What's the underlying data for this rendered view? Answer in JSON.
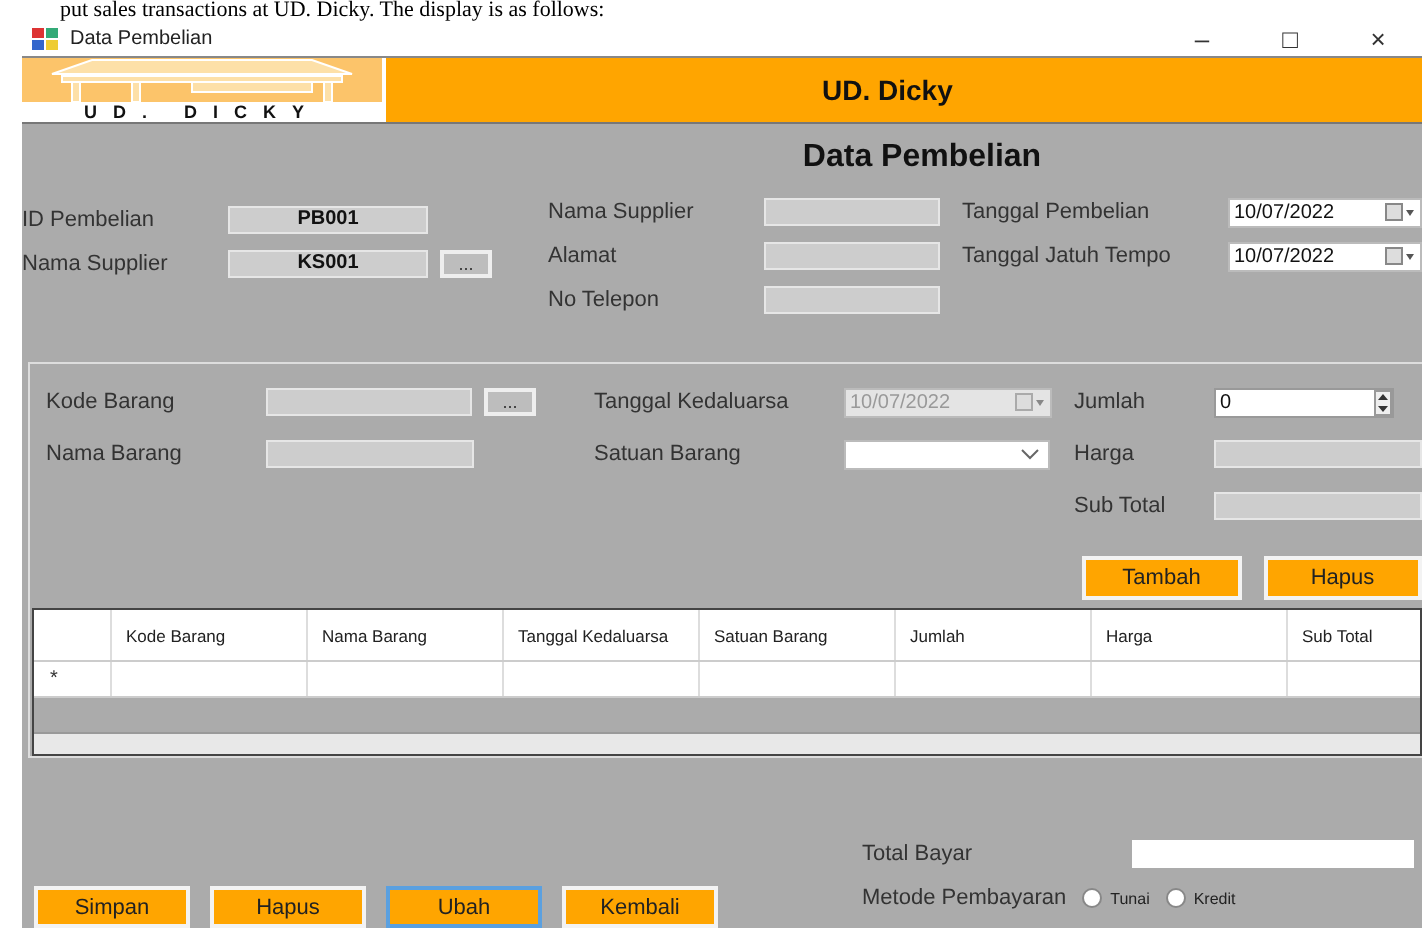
{
  "caption": "put sales transactions at UD. Dicky. The display is as follows:",
  "window": {
    "title": "Data Pembelian",
    "controls": [
      "–",
      "□",
      "×"
    ]
  },
  "banner": {
    "logo_text": "UD. DICKY",
    "title": "UD. Dicky"
  },
  "heading": "Data Pembelian",
  "header_left": [
    {
      "label": "ID Pembelian",
      "value": "PB001"
    },
    {
      "label": "Nama Supplier",
      "value": "KS001",
      "button": "..."
    }
  ],
  "header_middle": [
    {
      "label": "Nama Supplier"
    },
    {
      "label": "Alamat"
    },
    {
      "label": "No Telepon"
    }
  ],
  "header_right": [
    {
      "label": "Tanggal Pembelian",
      "value": "10/07/2022",
      "disabled": false
    },
    {
      "label": "Tanggal Jatuh Tempo",
      "value": "10/07/2022",
      "disabled": false
    }
  ],
  "item_form": {
    "left": [
      {
        "label": "Kode Barang",
        "kind": "browse",
        "button": "..."
      },
      {
        "label": "Nama Barang",
        "kind": "text"
      }
    ],
    "middle": [
      {
        "label": "Tanggal Kedaluarsa",
        "kind": "date",
        "value": "10/07/2022",
        "disabled": true
      },
      {
        "label": "Satuan Barang",
        "kind": "combo"
      }
    ],
    "right": [
      {
        "label": "Jumlah",
        "kind": "number",
        "value": "0"
      },
      {
        "label": "Harga",
        "kind": "text"
      },
      {
        "label": "Sub Total",
        "kind": "text"
      }
    ],
    "buttons": [
      "Tambah",
      "Hapus"
    ]
  },
  "table": {
    "columns": [
      "Kode Barang",
      "Nama Barang",
      "Tanggal Kedaluarsa",
      "Satuan Barang",
      "Jumlah",
      "Harga",
      "Sub Total"
    ],
    "new_row_marker": "*"
  },
  "actions": [
    {
      "label": "Simpan",
      "focused": false
    },
    {
      "label": "Hapus",
      "focused": false
    },
    {
      "label": "Ubah",
      "focused": true
    },
    {
      "label": "Kembali",
      "focused": false
    }
  ],
  "total": {
    "label": "Total Bayar"
  },
  "payment": {
    "label": "Metode Pembayaran",
    "options": [
      {
        "label": "Tunai",
        "selected": false
      },
      {
        "label": "Kredit",
        "selected": false
      }
    ]
  }
}
